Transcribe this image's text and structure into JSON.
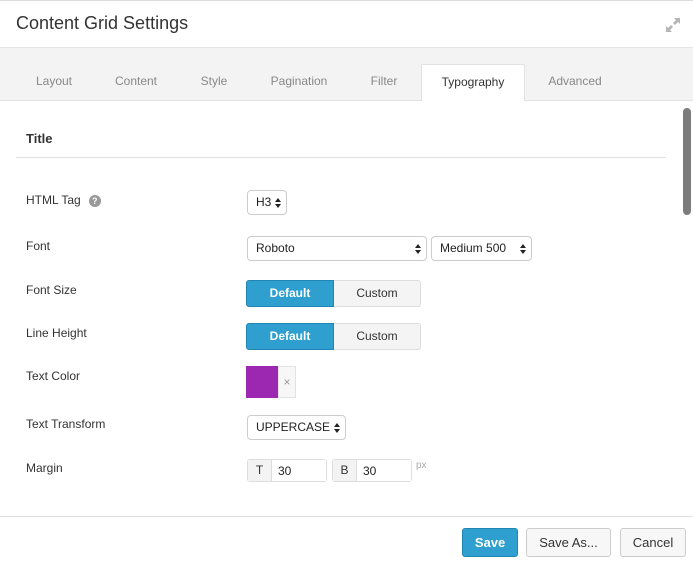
{
  "header": {
    "title": "Content Grid Settings",
    "expand_icon": "expand-arrows-icon"
  },
  "tabs": [
    {
      "label": "Layout",
      "active": false
    },
    {
      "label": "Content",
      "active": false
    },
    {
      "label": "Style",
      "active": false
    },
    {
      "label": "Pagination",
      "active": false
    },
    {
      "label": "Filter",
      "active": false
    },
    {
      "label": "Typography",
      "active": true
    },
    {
      "label": "Advanced",
      "active": false
    }
  ],
  "section": {
    "title": "Title"
  },
  "fields": {
    "html_tag": {
      "label": "HTML Tag",
      "help_icon": "question-circle-icon",
      "value": "H3"
    },
    "font": {
      "label": "Font",
      "family": "Roboto",
      "weight": "Medium 500"
    },
    "font_size": {
      "label": "Font Size",
      "options": [
        "Default",
        "Custom"
      ],
      "selected": "Default"
    },
    "line_height": {
      "label": "Line Height",
      "options": [
        "Default",
        "Custom"
      ],
      "selected": "Default"
    },
    "text_color": {
      "label": "Text Color",
      "value": "#9c27b0",
      "clear_glyph": "×"
    },
    "text_transform": {
      "label": "Text Transform",
      "value": "UPPERCASE"
    },
    "margin": {
      "label": "Margin",
      "top_addon": "T",
      "top_value": "30",
      "bottom_addon": "B",
      "bottom_value": "30",
      "unit": "px"
    }
  },
  "footer": {
    "save_label": "Save",
    "save_as_label": "Save As...",
    "cancel_label": "Cancel"
  },
  "colors": {
    "accent": "#2e9fcf",
    "text_color_swatch": "#9c27b0"
  }
}
